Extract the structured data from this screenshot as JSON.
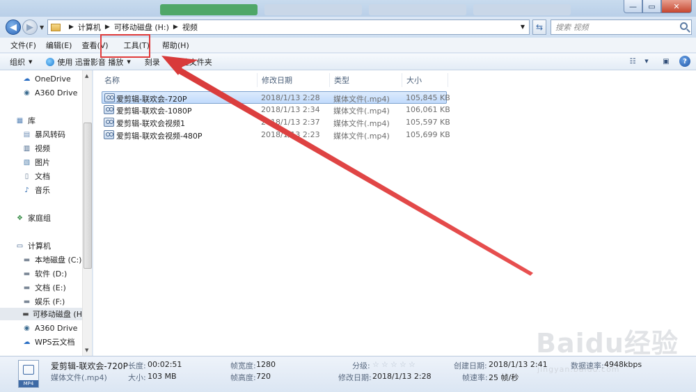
{
  "titlebar": {
    "controls": [
      "—",
      "▭",
      "✕"
    ]
  },
  "address": {
    "crumbs": [
      "计算机",
      "可移动磁盘 (H:)",
      "视频"
    ],
    "search_placeholder": "搜索 视频"
  },
  "menu": {
    "items": [
      "文件(F)",
      "编辑(E)",
      "查看(V)",
      "工具(T)",
      "帮助(H)"
    ]
  },
  "toolbar": {
    "organize": "组织",
    "play_with": "使用 迅雷影音 播放",
    "burn": "刻录",
    "new_folder": "新建文件夹"
  },
  "nav": {
    "items": [
      {
        "label": "OneDrive",
        "icon": "cloud-icon"
      },
      {
        "label": "A360 Drive",
        "icon": "drive-icon"
      },
      {
        "label": "库",
        "icon": "library-icon"
      },
      {
        "label": "暴风转码",
        "icon": "library-folder-icon"
      },
      {
        "label": "视频",
        "icon": "video-library-icon"
      },
      {
        "label": "图片",
        "icon": "picture-library-icon"
      },
      {
        "label": "文档",
        "icon": "document-library-icon"
      },
      {
        "label": "音乐",
        "icon": "music-library-icon"
      },
      {
        "label": "家庭组",
        "icon": "homegroup-icon"
      },
      {
        "label": "计算机",
        "icon": "computer-icon"
      },
      {
        "label": "本地磁盘 (C:)",
        "icon": "disk-icon"
      },
      {
        "label": "软件 (D:)",
        "icon": "disk-icon"
      },
      {
        "label": "文档 (E:)",
        "icon": "disk-icon"
      },
      {
        "label": "娱乐 (F:)",
        "icon": "disk-icon"
      },
      {
        "label": "可移动磁盘 (H",
        "icon": "removable-disk-icon"
      },
      {
        "label": "A360 Drive",
        "icon": "drive-icon"
      },
      {
        "label": "WPS云文档",
        "icon": "cloud-icon"
      }
    ]
  },
  "columns": {
    "name": "名称",
    "modified": "修改日期",
    "type": "类型",
    "size": "大小"
  },
  "files": [
    {
      "name": "爱剪辑-联欢会-720P",
      "modified": "2018/1/13 2:28",
      "type": "媒体文件(.mp4)",
      "size": "105,845 KB"
    },
    {
      "name": "爱剪辑-联欢会-1080P",
      "modified": "2018/1/13 2:34",
      "type": "媒体文件(.mp4)",
      "size": "106,061 KB"
    },
    {
      "name": "爱剪辑-联欢会视频1",
      "modified": "2018/1/13 2:37",
      "type": "媒体文件(.mp4)",
      "size": "105,597 KB"
    },
    {
      "name": "爱剪辑-联欢会视频-480P",
      "modified": "2018/1/13 2:23",
      "type": "媒体文件(.mp4)",
      "size": "105,699 KB"
    }
  ],
  "details": {
    "icon_label": "MP4",
    "title": "爱剪辑-联欢会-720P",
    "type": "媒体文件(.mp4)",
    "length_label": "长度:",
    "length": "00:02:51",
    "size_label": "大小:",
    "size": "103 MB",
    "width_label": "帧宽度:",
    "width": "1280",
    "height_label": "帧高度:",
    "height": "720",
    "rating_label": "分级:",
    "rating": 0,
    "modified_label": "修改日期:",
    "modified": "2018/1/13 2:28",
    "created_label": "创建日期:",
    "created": "2018/1/13 2:41",
    "framerate_label": "帧速率:",
    "framerate": "25 帧/秒",
    "datarate_label": "数据速率:",
    "datarate": "4948kbps"
  },
  "watermark": {
    "brand": "Baidu经验",
    "url": "jingyan.baidu.com"
  },
  "colors": {
    "highlight_box": "#e03a3a",
    "arrow": "#d83a3a",
    "selection": "#c1dbfc"
  }
}
